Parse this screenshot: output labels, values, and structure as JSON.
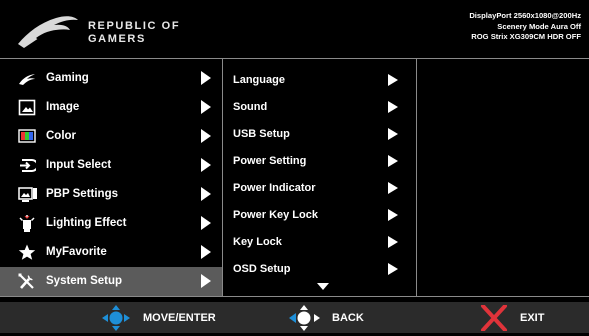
{
  "header": {
    "brand": "REPUBLIC OF\nGAMERS",
    "status_lines": [
      "DisplayPort 2560x1080@200Hz",
      "Scenery Mode Aura Off",
      "ROG Strix XG309CM HDR OFF"
    ]
  },
  "menu": {
    "items": [
      {
        "label": "Gaming",
        "icon": "rog-eye-icon",
        "selected": false
      },
      {
        "label": "Image",
        "icon": "image-icon",
        "selected": false
      },
      {
        "label": "Color",
        "icon": "color-icon",
        "selected": false
      },
      {
        "label": "Input Select",
        "icon": "input-select-icon",
        "selected": false
      },
      {
        "label": "PBP Settings",
        "icon": "pbp-icon",
        "selected": false
      },
      {
        "label": "Lighting Effect",
        "icon": "lighting-icon",
        "selected": false
      },
      {
        "label": "MyFavorite",
        "icon": "star-icon",
        "selected": false
      },
      {
        "label": "System Setup",
        "icon": "wrench-icon",
        "selected": true
      }
    ]
  },
  "submenu": {
    "items": [
      "Language",
      "Sound",
      "USB Setup",
      "Power Setting",
      "Power Indicator",
      "Power Key Lock",
      "Key Lock",
      "OSD Setup"
    ]
  },
  "footer": {
    "move_label": "MOVE/ENTER",
    "back_label": "BACK",
    "exit_label": "EXIT"
  },
  "colors": {
    "background": "#000000",
    "selected": "#5b5b5b",
    "divider": "#8a8a8a",
    "footer": "#2b2b2b",
    "joystick": "#1e8fd8",
    "exit": "#e0333a"
  }
}
